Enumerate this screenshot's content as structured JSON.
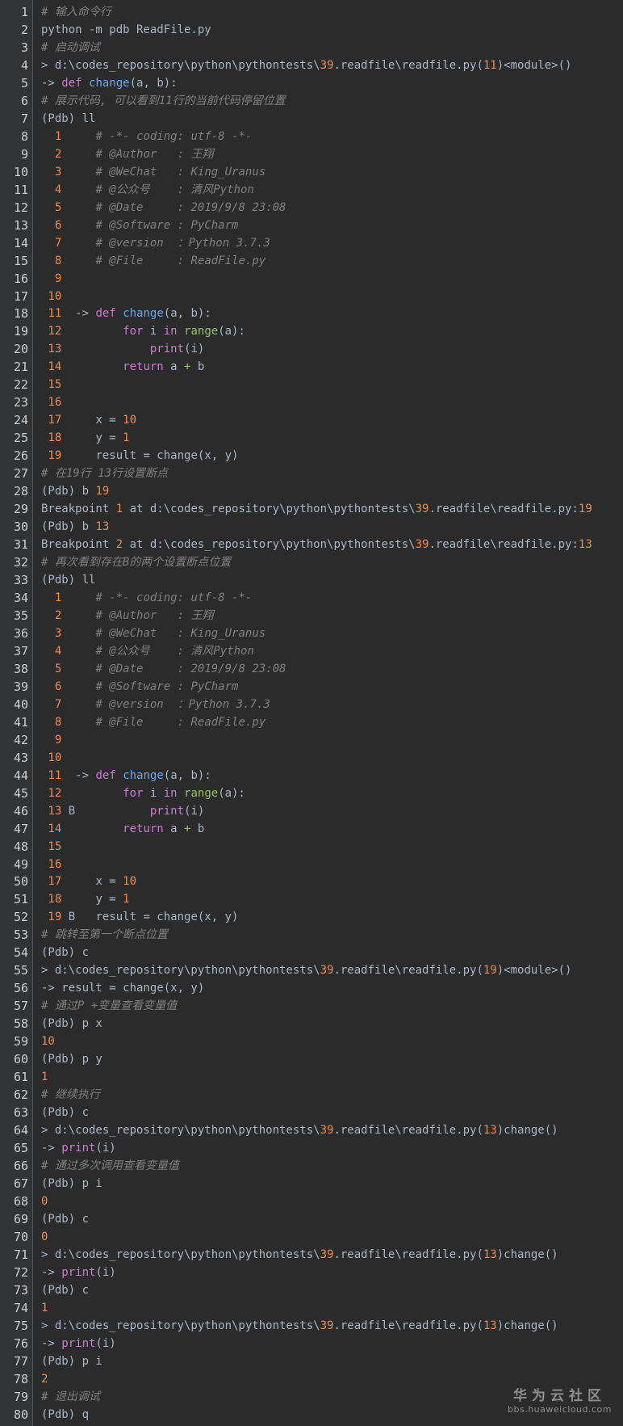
{
  "colors": {
    "background": "#2b2b2b",
    "gutter": "#313335",
    "line_number": "#d0d0d0",
    "plain": "#a9b7c6",
    "comment": "#808080",
    "number": "#ee8c4c",
    "keyword": "#cc7bd2",
    "function": "#6fa6e8",
    "builtin": "#96c06a"
  },
  "watermark": {
    "title": "华为云社区",
    "url": "bbs.huaweicloud.com"
  },
  "lines": [
    {
      "n": "1",
      "t": [
        [
          "comment",
          "# 输入命令行"
        ]
      ]
    },
    {
      "n": "2",
      "t": [
        [
          "plain",
          "python -m pdb ReadFile.py"
        ]
      ]
    },
    {
      "n": "3",
      "t": [
        [
          "comment",
          "# 启动调试"
        ]
      ]
    },
    {
      "n": "4",
      "t": [
        [
          "plain",
          "> d:\\codes_repository\\python\\pythontests\\"
        ],
        [
          "num",
          "39"
        ],
        [
          "plain",
          ".readfile\\readfile.py("
        ],
        [
          "num",
          "11"
        ],
        [
          "plain",
          ")<module>()"
        ]
      ]
    },
    {
      "n": "5",
      "t": [
        [
          "plain",
          "-> "
        ],
        [
          "kw",
          "def"
        ],
        [
          "plain",
          " "
        ],
        [
          "fn",
          "change"
        ],
        [
          "plain",
          "(a, b):"
        ]
      ]
    },
    {
      "n": "6",
      "t": [
        [
          "comment",
          "# 展示代码, 可以看到11行的当前代码停留位置"
        ]
      ]
    },
    {
      "n": "7",
      "t": [
        [
          "plain",
          "(Pdb) ll"
        ]
      ]
    },
    {
      "n": "8",
      "t": [
        [
          "num",
          "  1"
        ],
        [
          "plain",
          "     "
        ],
        [
          "comment",
          "# -*- coding: utf-8 -*-"
        ]
      ]
    },
    {
      "n": "9",
      "t": [
        [
          "num",
          "  2"
        ],
        [
          "plain",
          "     "
        ],
        [
          "comment",
          "# @Author   : 王翔"
        ]
      ]
    },
    {
      "n": "10",
      "t": [
        [
          "num",
          "  3"
        ],
        [
          "plain",
          "     "
        ],
        [
          "comment",
          "# @WeChat   : King_Uranus"
        ]
      ]
    },
    {
      "n": "11",
      "t": [
        [
          "num",
          "  4"
        ],
        [
          "plain",
          "     "
        ],
        [
          "comment",
          "# @公众号    : 清风Python"
        ]
      ]
    },
    {
      "n": "12",
      "t": [
        [
          "num",
          "  5"
        ],
        [
          "plain",
          "     "
        ],
        [
          "comment",
          "# @Date     : 2019/9/8 23:08"
        ]
      ]
    },
    {
      "n": "13",
      "t": [
        [
          "num",
          "  6"
        ],
        [
          "plain",
          "     "
        ],
        [
          "comment",
          "# @Software : PyCharm"
        ]
      ]
    },
    {
      "n": "14",
      "t": [
        [
          "num",
          "  7"
        ],
        [
          "plain",
          "     "
        ],
        [
          "comment",
          "# @version  ：Python 3.7.3"
        ]
      ]
    },
    {
      "n": "15",
      "t": [
        [
          "num",
          "  8"
        ],
        [
          "plain",
          "     "
        ],
        [
          "comment",
          "# @File     : ReadFile.py"
        ]
      ]
    },
    {
      "n": "16",
      "t": [
        [
          "num",
          "  9"
        ]
      ]
    },
    {
      "n": "17",
      "t": [
        [
          "num",
          " 10"
        ]
      ]
    },
    {
      "n": "18",
      "t": [
        [
          "num",
          " 11"
        ],
        [
          "plain",
          "  -> "
        ],
        [
          "kw",
          "def"
        ],
        [
          "plain",
          " "
        ],
        [
          "fn",
          "change"
        ],
        [
          "plain",
          "(a, b):"
        ]
      ]
    },
    {
      "n": "19",
      "t": [
        [
          "num",
          " 12"
        ],
        [
          "plain",
          "         "
        ],
        [
          "kw",
          "for"
        ],
        [
          "plain",
          " i "
        ],
        [
          "kw",
          "in"
        ],
        [
          "plain",
          " "
        ],
        [
          "builtin",
          "range"
        ],
        [
          "plain",
          "(a):"
        ]
      ]
    },
    {
      "n": "20",
      "t": [
        [
          "num",
          " 13"
        ],
        [
          "plain",
          "             "
        ],
        [
          "kw",
          "print"
        ],
        [
          "plain",
          "(i)"
        ]
      ]
    },
    {
      "n": "21",
      "t": [
        [
          "num",
          " 14"
        ],
        [
          "plain",
          "         "
        ],
        [
          "kw",
          "return"
        ],
        [
          "plain",
          " a "
        ],
        [
          "builtin",
          "+"
        ],
        [
          "plain",
          " b"
        ]
      ]
    },
    {
      "n": "22",
      "t": [
        [
          "num",
          " 15"
        ]
      ]
    },
    {
      "n": "23",
      "t": [
        [
          "num",
          " 16"
        ]
      ]
    },
    {
      "n": "24",
      "t": [
        [
          "num",
          " 17"
        ],
        [
          "plain",
          "     x = "
        ],
        [
          "num",
          "10"
        ]
      ]
    },
    {
      "n": "25",
      "t": [
        [
          "num",
          " 18"
        ],
        [
          "plain",
          "     y = "
        ],
        [
          "num",
          "1"
        ]
      ]
    },
    {
      "n": "26",
      "t": [
        [
          "num",
          " 19"
        ],
        [
          "plain",
          "     result = change(x, y)"
        ]
      ]
    },
    {
      "n": "27",
      "t": [
        [
          "comment",
          "# 在19行 13行设置断点"
        ]
      ]
    },
    {
      "n": "28",
      "t": [
        [
          "plain",
          "(Pdb) b "
        ],
        [
          "num",
          "19"
        ]
      ]
    },
    {
      "n": "29",
      "t": [
        [
          "plain",
          "Breakpoint "
        ],
        [
          "num",
          "1"
        ],
        [
          "plain",
          " at d:\\codes_repository\\python\\pythontests\\"
        ],
        [
          "num",
          "39"
        ],
        [
          "plain",
          ".readfile\\readfile.py:"
        ],
        [
          "num",
          "19"
        ]
      ]
    },
    {
      "n": "30",
      "t": [
        [
          "plain",
          "(Pdb) b "
        ],
        [
          "num",
          "13"
        ]
      ]
    },
    {
      "n": "31",
      "t": [
        [
          "plain",
          "Breakpoint "
        ],
        [
          "num",
          "2"
        ],
        [
          "plain",
          " at d:\\codes_repository\\python\\pythontests\\"
        ],
        [
          "num",
          "39"
        ],
        [
          "plain",
          ".readfile\\readfile.py:"
        ],
        [
          "num",
          "13"
        ]
      ]
    },
    {
      "n": "32",
      "t": [
        [
          "comment",
          "# 再次看到存在B的两个设置断点位置"
        ]
      ]
    },
    {
      "n": "33",
      "t": [
        [
          "plain",
          "(Pdb) ll"
        ]
      ]
    },
    {
      "n": "34",
      "t": [
        [
          "num",
          "  1"
        ],
        [
          "plain",
          "     "
        ],
        [
          "comment",
          "# -*- coding: utf-8 -*-"
        ]
      ]
    },
    {
      "n": "35",
      "t": [
        [
          "num",
          "  2"
        ],
        [
          "plain",
          "     "
        ],
        [
          "comment",
          "# @Author   : 王翔"
        ]
      ]
    },
    {
      "n": "36",
      "t": [
        [
          "num",
          "  3"
        ],
        [
          "plain",
          "     "
        ],
        [
          "comment",
          "# @WeChat   : King_Uranus"
        ]
      ]
    },
    {
      "n": "37",
      "t": [
        [
          "num",
          "  4"
        ],
        [
          "plain",
          "     "
        ],
        [
          "comment",
          "# @公众号    : 清风Python"
        ]
      ]
    },
    {
      "n": "38",
      "t": [
        [
          "num",
          "  5"
        ],
        [
          "plain",
          "     "
        ],
        [
          "comment",
          "# @Date     : 2019/9/8 23:08"
        ]
      ]
    },
    {
      "n": "39",
      "t": [
        [
          "num",
          "  6"
        ],
        [
          "plain",
          "     "
        ],
        [
          "comment",
          "# @Software : PyCharm"
        ]
      ]
    },
    {
      "n": "40",
      "t": [
        [
          "num",
          "  7"
        ],
        [
          "plain",
          "     "
        ],
        [
          "comment",
          "# @version  ：Python 3.7.3"
        ]
      ]
    },
    {
      "n": "41",
      "t": [
        [
          "num",
          "  8"
        ],
        [
          "plain",
          "     "
        ],
        [
          "comment",
          "# @File     : ReadFile.py"
        ]
      ]
    },
    {
      "n": "42",
      "t": [
        [
          "num",
          "  9"
        ]
      ]
    },
    {
      "n": "43",
      "t": [
        [
          "num",
          " 10"
        ]
      ]
    },
    {
      "n": "44",
      "t": [
        [
          "num",
          " 11"
        ],
        [
          "plain",
          "  -> "
        ],
        [
          "kw",
          "def"
        ],
        [
          "plain",
          " "
        ],
        [
          "fn",
          "change"
        ],
        [
          "plain",
          "(a, b):"
        ]
      ]
    },
    {
      "n": "45",
      "t": [
        [
          "num",
          " 12"
        ],
        [
          "plain",
          "         "
        ],
        [
          "kw",
          "for"
        ],
        [
          "plain",
          " i "
        ],
        [
          "kw",
          "in"
        ],
        [
          "plain",
          " "
        ],
        [
          "builtin",
          "range"
        ],
        [
          "plain",
          "(a):"
        ]
      ]
    },
    {
      "n": "46",
      "t": [
        [
          "num",
          " 13"
        ],
        [
          "plain",
          " B           "
        ],
        [
          "kw",
          "print"
        ],
        [
          "plain",
          "(i)"
        ]
      ]
    },
    {
      "n": "47",
      "t": [
        [
          "num",
          " 14"
        ],
        [
          "plain",
          "         "
        ],
        [
          "kw",
          "return"
        ],
        [
          "plain",
          " a "
        ],
        [
          "builtin",
          "+"
        ],
        [
          "plain",
          " b"
        ]
      ]
    },
    {
      "n": "48",
      "t": [
        [
          "num",
          " 15"
        ]
      ]
    },
    {
      "n": "49",
      "t": [
        [
          "num",
          " 16"
        ]
      ]
    },
    {
      "n": "50",
      "t": [
        [
          "num",
          " 17"
        ],
        [
          "plain",
          "     x = "
        ],
        [
          "num",
          "10"
        ]
      ]
    },
    {
      "n": "51",
      "t": [
        [
          "num",
          " 18"
        ],
        [
          "plain",
          "     y = "
        ],
        [
          "num",
          "1"
        ]
      ]
    },
    {
      "n": "52",
      "t": [
        [
          "num",
          " 19"
        ],
        [
          "plain",
          " B   result = change(x, y)"
        ]
      ]
    },
    {
      "n": "53",
      "t": [
        [
          "comment",
          "# 跳转至第一个断点位置"
        ]
      ]
    },
    {
      "n": "54",
      "t": [
        [
          "plain",
          "(Pdb) c"
        ]
      ]
    },
    {
      "n": "55",
      "t": [
        [
          "plain",
          "> d:\\codes_repository\\python\\pythontests\\"
        ],
        [
          "num",
          "39"
        ],
        [
          "plain",
          ".readfile\\readfile.py("
        ],
        [
          "num",
          "19"
        ],
        [
          "plain",
          ")<module>()"
        ]
      ]
    },
    {
      "n": "56",
      "t": [
        [
          "plain",
          "-> result = change(x, y)"
        ]
      ]
    },
    {
      "n": "57",
      "t": [
        [
          "comment",
          "# 通过P +变量查看变量值"
        ]
      ]
    },
    {
      "n": "58",
      "t": [
        [
          "plain",
          "(Pdb) p x"
        ]
      ]
    },
    {
      "n": "59",
      "t": [
        [
          "num",
          "10"
        ]
      ]
    },
    {
      "n": "60",
      "t": [
        [
          "plain",
          "(Pdb) p y"
        ]
      ]
    },
    {
      "n": "61",
      "t": [
        [
          "num",
          "1"
        ]
      ]
    },
    {
      "n": "62",
      "t": [
        [
          "comment",
          "# 继续执行"
        ]
      ]
    },
    {
      "n": "63",
      "t": [
        [
          "plain",
          "(Pdb) c"
        ]
      ]
    },
    {
      "n": "64",
      "t": [
        [
          "plain",
          "> d:\\codes_repository\\python\\pythontests\\"
        ],
        [
          "num",
          "39"
        ],
        [
          "plain",
          ".readfile\\readfile.py("
        ],
        [
          "num",
          "13"
        ],
        [
          "plain",
          ")change()"
        ]
      ]
    },
    {
      "n": "65",
      "t": [
        [
          "plain",
          "-> "
        ],
        [
          "kw",
          "print"
        ],
        [
          "plain",
          "(i)"
        ]
      ]
    },
    {
      "n": "66",
      "t": [
        [
          "comment",
          "# 通过多次调用查看变量值"
        ]
      ]
    },
    {
      "n": "67",
      "t": [
        [
          "plain",
          "(Pdb) p i"
        ]
      ]
    },
    {
      "n": "68",
      "t": [
        [
          "num",
          "0"
        ]
      ]
    },
    {
      "n": "69",
      "t": [
        [
          "plain",
          "(Pdb) c"
        ]
      ]
    },
    {
      "n": "70",
      "t": [
        [
          "num",
          "0"
        ]
      ]
    },
    {
      "n": "71",
      "t": [
        [
          "plain",
          "> d:\\codes_repository\\python\\pythontests\\"
        ],
        [
          "num",
          "39"
        ],
        [
          "plain",
          ".readfile\\readfile.py("
        ],
        [
          "num",
          "13"
        ],
        [
          "plain",
          ")change()"
        ]
      ]
    },
    {
      "n": "72",
      "t": [
        [
          "plain",
          "-> "
        ],
        [
          "kw",
          "print"
        ],
        [
          "plain",
          "(i)"
        ]
      ]
    },
    {
      "n": "73",
      "t": [
        [
          "plain",
          "(Pdb) c"
        ]
      ]
    },
    {
      "n": "74",
      "t": [
        [
          "num",
          "1"
        ]
      ]
    },
    {
      "n": "75",
      "t": [
        [
          "plain",
          "> d:\\codes_repository\\python\\pythontests\\"
        ],
        [
          "num",
          "39"
        ],
        [
          "plain",
          ".readfile\\readfile.py("
        ],
        [
          "num",
          "13"
        ],
        [
          "plain",
          ")change()"
        ]
      ]
    },
    {
      "n": "76",
      "t": [
        [
          "plain",
          "-> "
        ],
        [
          "kw",
          "print"
        ],
        [
          "plain",
          "(i)"
        ]
      ]
    },
    {
      "n": "77",
      "t": [
        [
          "plain",
          "(Pdb) p i"
        ]
      ]
    },
    {
      "n": "78",
      "t": [
        [
          "num",
          "2"
        ]
      ]
    },
    {
      "n": "79",
      "t": [
        [
          "comment",
          "# 退出调试"
        ]
      ]
    },
    {
      "n": "80",
      "t": [
        [
          "plain",
          "(Pdb) q"
        ]
      ]
    }
  ]
}
